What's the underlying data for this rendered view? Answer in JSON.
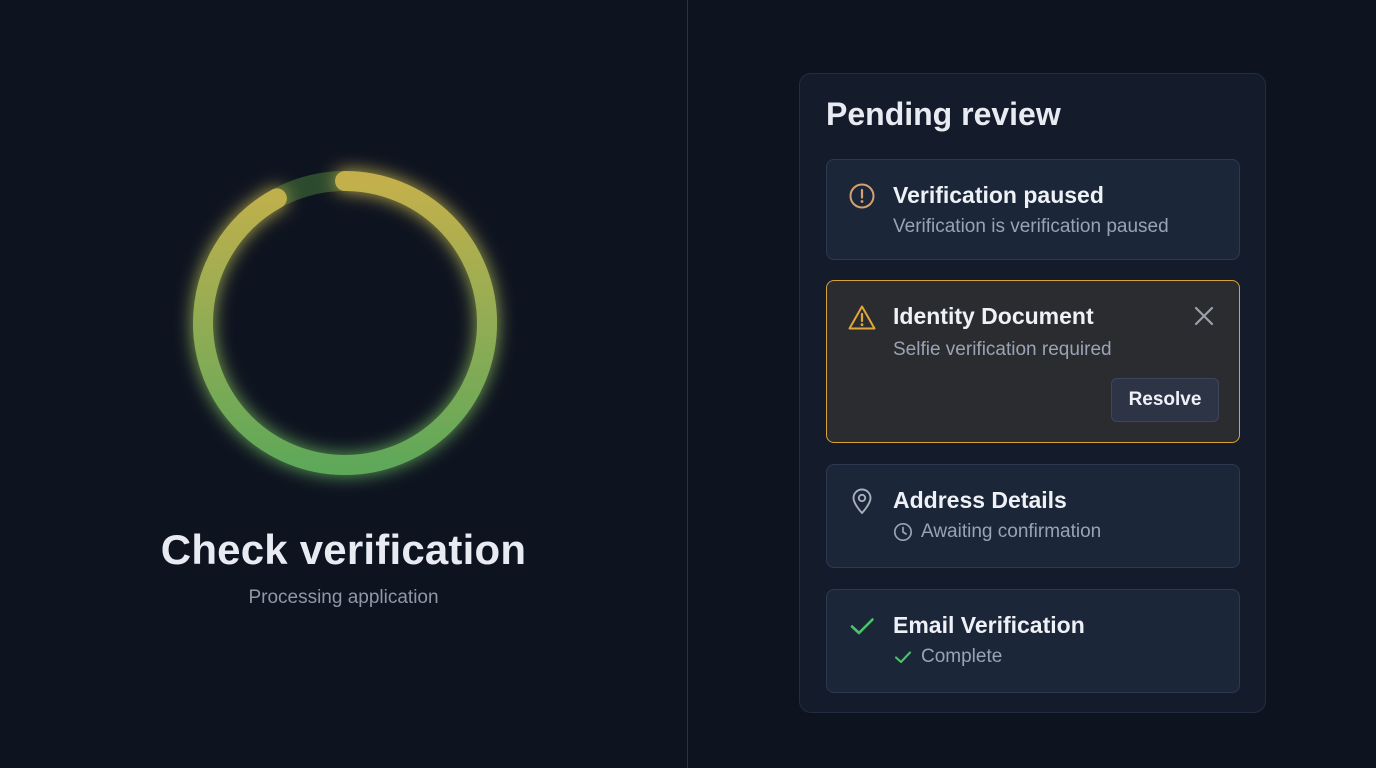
{
  "status": {
    "title": "Check verification",
    "subtitle": "Processing application",
    "progress_fraction": 0.92,
    "colors": {
      "start": "#5fa85a",
      "end": "#c4b04c",
      "track": "#2c4a2e"
    }
  },
  "panel": {
    "title": "Pending review",
    "cards": [
      {
        "icon": "alert-circle-icon",
        "title": "Verification paused",
        "subtitle": "Verification is verification paused"
      },
      {
        "icon": "warning-triangle-icon",
        "title": "Identity Document",
        "subtitle": "Selfie verification required",
        "action_label": "Resolve",
        "dismiss_icon": "close-icon"
      },
      {
        "icon": "location-pin-icon",
        "title": "Address Details",
        "status_icon": "clock-icon",
        "subtitle": "Awaiting confirmation"
      },
      {
        "icon": "checkmark-icon",
        "title": "Email Verification",
        "status_icon": "checkmark-icon",
        "subtitle": "Complete"
      }
    ]
  },
  "colors": {
    "background": "#0e1320",
    "panel": "#141c2c",
    "card": "#1c2639",
    "warning_accent": "#d9a238",
    "success": "#4cc36a",
    "muted_text": "#9aa3b5"
  }
}
